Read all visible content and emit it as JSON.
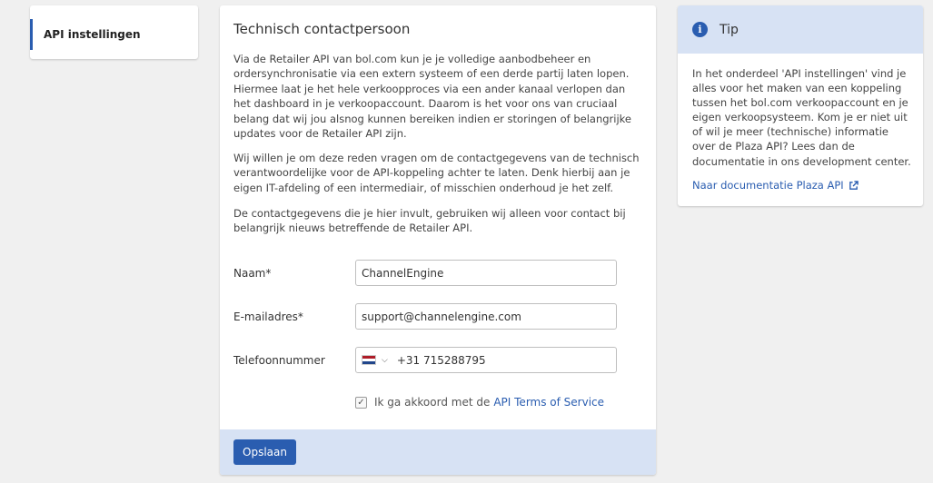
{
  "sidebar": {
    "items": [
      {
        "label": "API instellingen"
      }
    ]
  },
  "main": {
    "title": "Technisch contactpersoon",
    "paragraphs": [
      "Via de Retailer API van bol.com kun je je volledige aanbodbeheer en ordersynchronisatie via een extern systeem of een derde partij laten lopen. Hiermee laat je het hele verkoopproces via een ander kanaal verlopen dan het dashboard in je verkoopaccount. Daarom is het voor ons van cruciaal belang dat wij jou alsnog kunnen bereiken indien er storingen of belangrijke updates voor de Retailer API zijn.",
      "Wij willen je om deze reden vragen om de contactgegevens van de technisch verantwoordelijke voor de API-koppeling achter te laten. Denk hierbij aan je eigen IT-afdeling of een intermediair, of misschien onderhoud je het zelf.",
      "De contactgegevens die je hier invult, gebruiken wij alleen voor contact bij belangrijk nieuws betreffende de Retailer API."
    ],
    "form": {
      "name_label": "Naam*",
      "name_value": "ChannelEngine",
      "email_label": "E-mailadres*",
      "email_value": "support@channelengine.com",
      "phone_label": "Telefoonnummer",
      "phone_country": "NL",
      "phone_value": "+31 715288795",
      "terms_text": "Ik ga akkoord met de",
      "terms_link": "API Terms of Service",
      "terms_checked": true
    },
    "save_label": "Opslaan"
  },
  "tip": {
    "title": "Tip",
    "body": "In het onderdeel 'API instellingen' vind je alles voor het maken van een koppeling tussen het bol.com verkoopaccount en je eigen verkoopsysteem. Kom je er niet uit of wil je meer (technische) informatie over de Plaza API? Lees dan de documentatie in ons development center.",
    "link": "Naar documentatie Plaza API"
  },
  "colors": {
    "accent": "#2a5db0",
    "panel_header": "#d7e2f4",
    "background": "#f0f0f0"
  },
  "icons": [
    "info-icon",
    "external-link-icon",
    "nl-flag-icon",
    "chevron-down-icon",
    "checkmark-icon"
  ]
}
